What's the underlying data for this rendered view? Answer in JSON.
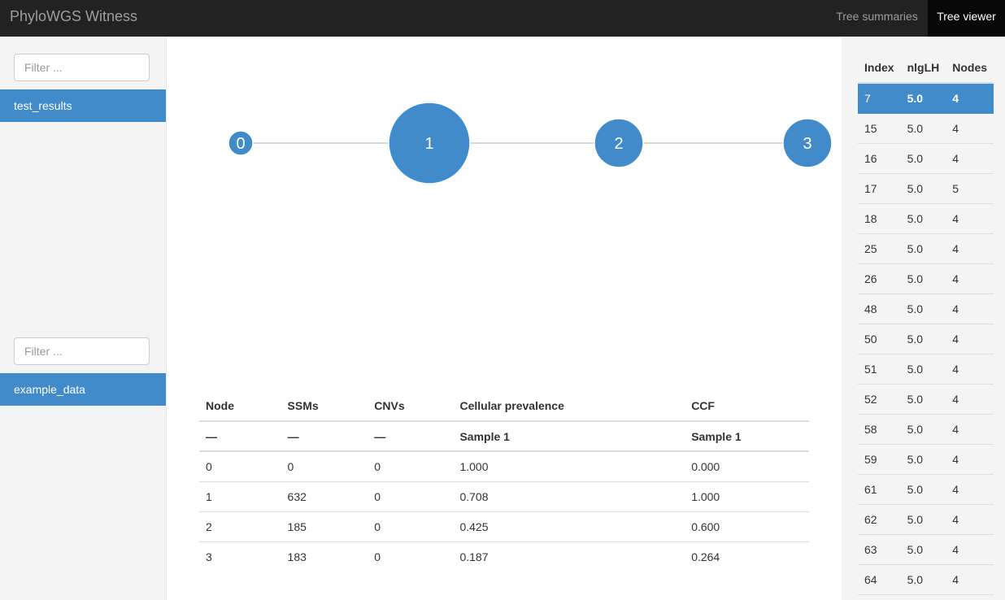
{
  "navbar": {
    "brand": "PhyloWGS Witness",
    "links": [
      {
        "label": "Tree summaries",
        "active": false
      },
      {
        "label": "Tree viewer",
        "active": true
      }
    ]
  },
  "sidebar": {
    "groups": [
      {
        "filter_placeholder": "Filter ...",
        "run": "test_results"
      },
      {
        "filter_placeholder": "Filter ...",
        "run": "example_data"
      }
    ]
  },
  "tree": {
    "accent_color": "#428bca",
    "nodes": [
      {
        "label": "0"
      },
      {
        "label": "1"
      },
      {
        "label": "2"
      },
      {
        "label": "3"
      }
    ]
  },
  "node_table": {
    "headers": [
      "Node",
      "SSMs",
      "CNVs",
      "Cellular prevalence",
      "CCF"
    ],
    "subheaders": [
      "—",
      "—",
      "—",
      "Sample 1",
      "Sample 1"
    ],
    "rows": [
      [
        "0",
        "0",
        "0",
        "1.000",
        "0.000"
      ],
      [
        "1",
        "632",
        "0",
        "0.708",
        "1.000"
      ],
      [
        "2",
        "185",
        "0",
        "0.425",
        "0.600"
      ],
      [
        "3",
        "183",
        "0",
        "0.187",
        "0.264"
      ]
    ]
  },
  "tree_list": {
    "headers": [
      "Index",
      "nlgLH",
      "Nodes"
    ],
    "selected_index": "7",
    "rows": [
      [
        "7",
        "5.0",
        "4"
      ],
      [
        "15",
        "5.0",
        "4"
      ],
      [
        "16",
        "5.0",
        "4"
      ],
      [
        "17",
        "5.0",
        "5"
      ],
      [
        "18",
        "5.0",
        "4"
      ],
      [
        "25",
        "5.0",
        "4"
      ],
      [
        "26",
        "5.0",
        "4"
      ],
      [
        "48",
        "5.0",
        "4"
      ],
      [
        "50",
        "5.0",
        "4"
      ],
      [
        "51",
        "5.0",
        "4"
      ],
      [
        "52",
        "5.0",
        "4"
      ],
      [
        "58",
        "5.0",
        "4"
      ],
      [
        "59",
        "5.0",
        "4"
      ],
      [
        "61",
        "5.0",
        "4"
      ],
      [
        "62",
        "5.0",
        "4"
      ],
      [
        "63",
        "5.0",
        "4"
      ],
      [
        "64",
        "5.0",
        "4"
      ]
    ]
  }
}
